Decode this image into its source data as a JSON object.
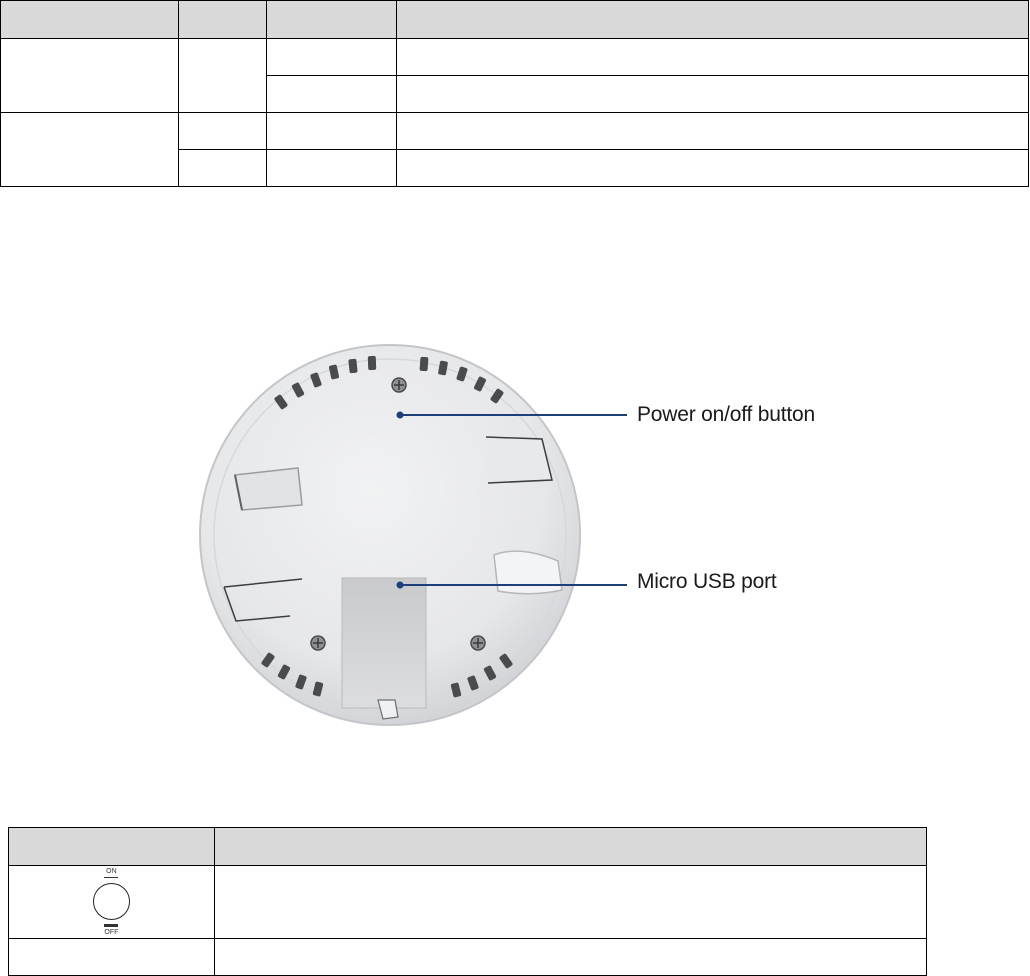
{
  "callouts": {
    "power_button": "Power on/off button",
    "usb_port": "Micro USB port"
  },
  "switch_icon": {
    "on_label": "ON",
    "off_label": "OFF"
  },
  "colors": {
    "callout_line": "#1f3f7a",
    "header_fill": "#d9d9d9",
    "device_body": "#e9eaeb"
  }
}
